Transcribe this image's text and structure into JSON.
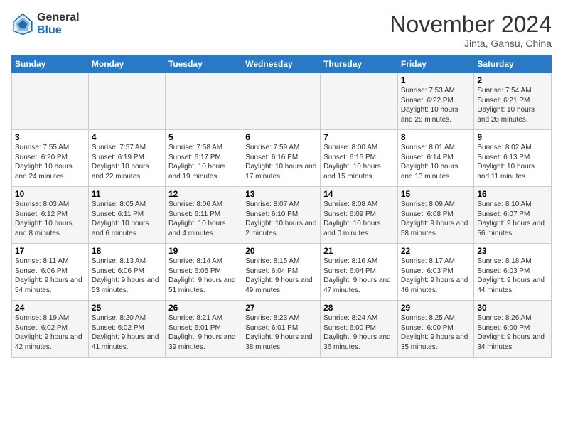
{
  "header": {
    "logo_line1": "General",
    "logo_line2": "Blue",
    "month_title": "November 2024",
    "location": "Jinta, Gansu, China"
  },
  "weekdays": [
    "Sunday",
    "Monday",
    "Tuesday",
    "Wednesday",
    "Thursday",
    "Friday",
    "Saturday"
  ],
  "weeks": [
    [
      {
        "day": "",
        "info": ""
      },
      {
        "day": "",
        "info": ""
      },
      {
        "day": "",
        "info": ""
      },
      {
        "day": "",
        "info": ""
      },
      {
        "day": "",
        "info": ""
      },
      {
        "day": "1",
        "info": "Sunrise: 7:53 AM\nSunset: 6:22 PM\nDaylight: 10 hours and 28 minutes."
      },
      {
        "day": "2",
        "info": "Sunrise: 7:54 AM\nSunset: 6:21 PM\nDaylight: 10 hours and 26 minutes."
      }
    ],
    [
      {
        "day": "3",
        "info": "Sunrise: 7:55 AM\nSunset: 6:20 PM\nDaylight: 10 hours and 24 minutes."
      },
      {
        "day": "4",
        "info": "Sunrise: 7:57 AM\nSunset: 6:19 PM\nDaylight: 10 hours and 22 minutes."
      },
      {
        "day": "5",
        "info": "Sunrise: 7:58 AM\nSunset: 6:17 PM\nDaylight: 10 hours and 19 minutes."
      },
      {
        "day": "6",
        "info": "Sunrise: 7:59 AM\nSunset: 6:16 PM\nDaylight: 10 hours and 17 minutes."
      },
      {
        "day": "7",
        "info": "Sunrise: 8:00 AM\nSunset: 6:15 PM\nDaylight: 10 hours and 15 minutes."
      },
      {
        "day": "8",
        "info": "Sunrise: 8:01 AM\nSunset: 6:14 PM\nDaylight: 10 hours and 13 minutes."
      },
      {
        "day": "9",
        "info": "Sunrise: 8:02 AM\nSunset: 6:13 PM\nDaylight: 10 hours and 11 minutes."
      }
    ],
    [
      {
        "day": "10",
        "info": "Sunrise: 8:03 AM\nSunset: 6:12 PM\nDaylight: 10 hours and 8 minutes."
      },
      {
        "day": "11",
        "info": "Sunrise: 8:05 AM\nSunset: 6:11 PM\nDaylight: 10 hours and 6 minutes."
      },
      {
        "day": "12",
        "info": "Sunrise: 8:06 AM\nSunset: 6:11 PM\nDaylight: 10 hours and 4 minutes."
      },
      {
        "day": "13",
        "info": "Sunrise: 8:07 AM\nSunset: 6:10 PM\nDaylight: 10 hours and 2 minutes."
      },
      {
        "day": "14",
        "info": "Sunrise: 8:08 AM\nSunset: 6:09 PM\nDaylight: 10 hours and 0 minutes."
      },
      {
        "day": "15",
        "info": "Sunrise: 8:09 AM\nSunset: 6:08 PM\nDaylight: 9 hours and 58 minutes."
      },
      {
        "day": "16",
        "info": "Sunrise: 8:10 AM\nSunset: 6:07 PM\nDaylight: 9 hours and 56 minutes."
      }
    ],
    [
      {
        "day": "17",
        "info": "Sunrise: 8:11 AM\nSunset: 6:06 PM\nDaylight: 9 hours and 54 minutes."
      },
      {
        "day": "18",
        "info": "Sunrise: 8:13 AM\nSunset: 6:06 PM\nDaylight: 9 hours and 53 minutes."
      },
      {
        "day": "19",
        "info": "Sunrise: 8:14 AM\nSunset: 6:05 PM\nDaylight: 9 hours and 51 minutes."
      },
      {
        "day": "20",
        "info": "Sunrise: 8:15 AM\nSunset: 6:04 PM\nDaylight: 9 hours and 49 minutes."
      },
      {
        "day": "21",
        "info": "Sunrise: 8:16 AM\nSunset: 6:04 PM\nDaylight: 9 hours and 47 minutes."
      },
      {
        "day": "22",
        "info": "Sunrise: 8:17 AM\nSunset: 6:03 PM\nDaylight: 9 hours and 46 minutes."
      },
      {
        "day": "23",
        "info": "Sunrise: 8:18 AM\nSunset: 6:03 PM\nDaylight: 9 hours and 44 minutes."
      }
    ],
    [
      {
        "day": "24",
        "info": "Sunrise: 8:19 AM\nSunset: 6:02 PM\nDaylight: 9 hours and 42 minutes."
      },
      {
        "day": "25",
        "info": "Sunrise: 8:20 AM\nSunset: 6:02 PM\nDaylight: 9 hours and 41 minutes."
      },
      {
        "day": "26",
        "info": "Sunrise: 8:21 AM\nSunset: 6:01 PM\nDaylight: 9 hours and 39 minutes."
      },
      {
        "day": "27",
        "info": "Sunrise: 8:23 AM\nSunset: 6:01 PM\nDaylight: 9 hours and 38 minutes."
      },
      {
        "day": "28",
        "info": "Sunrise: 8:24 AM\nSunset: 6:00 PM\nDaylight: 9 hours and 36 minutes."
      },
      {
        "day": "29",
        "info": "Sunrise: 8:25 AM\nSunset: 6:00 PM\nDaylight: 9 hours and 35 minutes."
      },
      {
        "day": "30",
        "info": "Sunrise: 8:26 AM\nSunset: 6:00 PM\nDaylight: 9 hours and 34 minutes."
      }
    ]
  ]
}
